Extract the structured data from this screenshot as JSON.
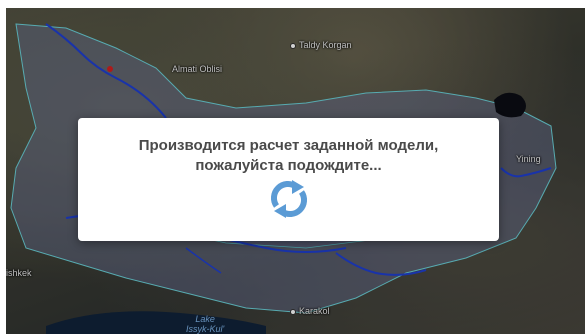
{
  "map": {
    "places": {
      "taldy_korgan": "Taldy Korgan",
      "almaty_oblisi": "Almati Oblisi",
      "yining": "Yining",
      "bishkek": "ishkek",
      "karakol": "Karakol",
      "lake_issyk_kul": "Lake\nIssyk-Kul'"
    }
  },
  "dialog": {
    "message": "Производится расчет заданной модели, пожалуйста подождите...",
    "spinner_icon": "refresh-icon",
    "spinner_color": "#5b9bd5"
  }
}
